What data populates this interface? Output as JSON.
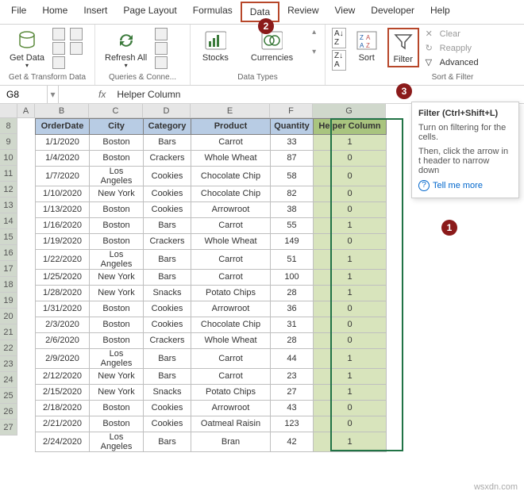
{
  "menu": [
    "File",
    "Home",
    "Insert",
    "Page Layout",
    "Formulas",
    "Data",
    "Review",
    "View",
    "Developer",
    "Help"
  ],
  "menu_active_index": 5,
  "ribbon": {
    "groups": [
      {
        "label": "Get & Transform Data",
        "items": [
          {
            "name": "Get Data",
            "icon": "db"
          }
        ]
      },
      {
        "label": "Queries & Conne...",
        "items": [
          {
            "name": "Refresh All",
            "icon": "refresh"
          }
        ]
      },
      {
        "label": "Data Types",
        "items": [
          {
            "name": "Stocks",
            "icon": "stocks"
          },
          {
            "name": "Currencies",
            "icon": "curr"
          }
        ]
      },
      {
        "label": "Sort & Filter",
        "items": [
          {
            "name": "Sort",
            "icon": "sort"
          },
          {
            "name": "Filter",
            "icon": "filter"
          }
        ],
        "side": [
          "Clear",
          "Reapply",
          "Advanced"
        ]
      }
    ],
    "sort_small": [
      "AZ",
      "ZA"
    ]
  },
  "badges": {
    "2": "2",
    "3": "3",
    "1": "1"
  },
  "tooltip": {
    "title": "Filter (Ctrl+Shift+L)",
    "body1": "Turn on filtering for the cells.",
    "body2": "Then, click the arrow in t header to narrow down",
    "link": "Tell me more"
  },
  "namebox": "G8",
  "formula": "Helper Column",
  "colheads": [
    "A",
    "B",
    "C",
    "D",
    "E",
    "F",
    "G"
  ],
  "rowheads": [
    8,
    9,
    10,
    11,
    12,
    13,
    14,
    15,
    16,
    17,
    18,
    19,
    20,
    21,
    22,
    23,
    24,
    25,
    26,
    27
  ],
  "table": {
    "headers": [
      "OrderDate",
      "City",
      "Category",
      "Product",
      "Quantity",
      "Helper Column"
    ],
    "rows": [
      [
        "1/1/2020",
        "Boston",
        "Bars",
        "Carrot",
        "33",
        "1"
      ],
      [
        "1/4/2020",
        "Boston",
        "Crackers",
        "Whole Wheat",
        "87",
        "0"
      ],
      [
        "1/7/2020",
        "Los Angeles",
        "Cookies",
        "Chocolate Chip",
        "58",
        "0"
      ],
      [
        "1/10/2020",
        "New York",
        "Cookies",
        "Chocolate Chip",
        "82",
        "0"
      ],
      [
        "1/13/2020",
        "Boston",
        "Cookies",
        "Arrowroot",
        "38",
        "0"
      ],
      [
        "1/16/2020",
        "Boston",
        "Bars",
        "Carrot",
        "55",
        "1"
      ],
      [
        "1/19/2020",
        "Boston",
        "Crackers",
        "Whole Wheat",
        "149",
        "0"
      ],
      [
        "1/22/2020",
        "Los Angeles",
        "Bars",
        "Carrot",
        "51",
        "1"
      ],
      [
        "1/25/2020",
        "New York",
        "Bars",
        "Carrot",
        "100",
        "1"
      ],
      [
        "1/28/2020",
        "New York",
        "Snacks",
        "Potato Chips",
        "28",
        "1"
      ],
      [
        "1/31/2020",
        "Boston",
        "Cookies",
        "Arrowroot",
        "36",
        "0"
      ],
      [
        "2/3/2020",
        "Boston",
        "Cookies",
        "Chocolate Chip",
        "31",
        "0"
      ],
      [
        "2/6/2020",
        "Boston",
        "Crackers",
        "Whole Wheat",
        "28",
        "0"
      ],
      [
        "2/9/2020",
        "Los Angeles",
        "Bars",
        "Carrot",
        "44",
        "1"
      ],
      [
        "2/12/2020",
        "New York",
        "Bars",
        "Carrot",
        "23",
        "1"
      ],
      [
        "2/15/2020",
        "New York",
        "Snacks",
        "Potato Chips",
        "27",
        "1"
      ],
      [
        "2/18/2020",
        "Boston",
        "Cookies",
        "Arrowroot",
        "43",
        "0"
      ],
      [
        "2/21/2020",
        "Boston",
        "Cookies",
        "Oatmeal Raisin",
        "123",
        "0"
      ],
      [
        "2/24/2020",
        "Los Angeles",
        "Bars",
        "Bran",
        "42",
        "1"
      ]
    ]
  },
  "watermark": "wsxdn.com"
}
